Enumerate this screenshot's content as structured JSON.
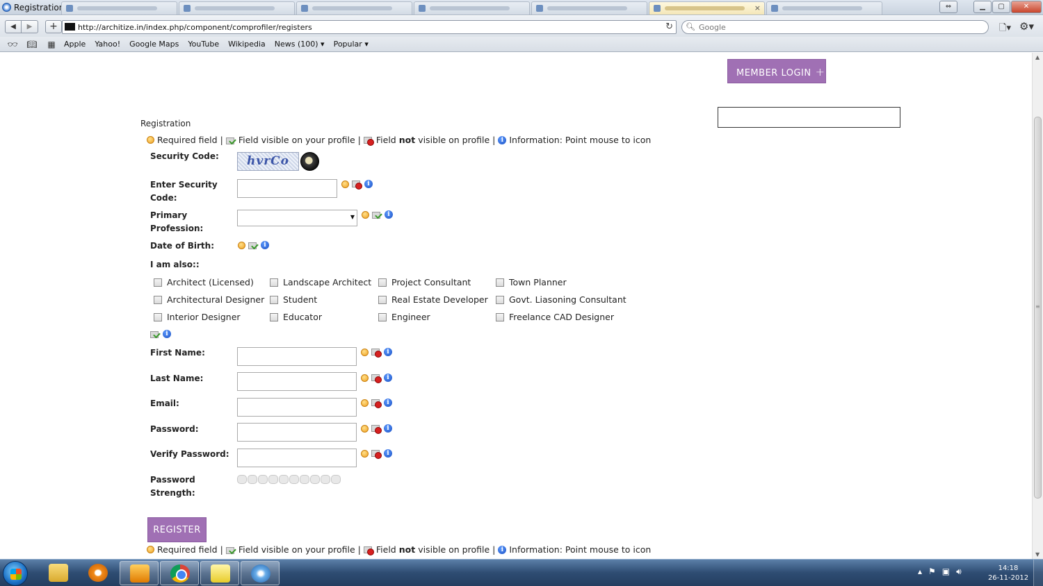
{
  "window": {
    "title": "Registration",
    "tab_count": 8,
    "active_tab_index": 6
  },
  "navbar": {
    "back_icon": "back-arrow-icon",
    "forward_icon": "forward-arrow-icon",
    "url": "http://architize.in/index.php/component/comprofiler/registers",
    "search_placeholder": "Google"
  },
  "bookmarks": {
    "items": [
      "Apple",
      "Yahoo!",
      "Google Maps",
      "YouTube",
      "Wikipedia",
      "News (100) ▾",
      "Popular ▾"
    ]
  },
  "header": {
    "member_login_label": "MEMBER LOGIN",
    "member_login_plus": "+"
  },
  "form": {
    "title": "Registration",
    "legend": {
      "required": "Required field",
      "visible": "Field visible on your profile",
      "not_visible_prefix": "Field",
      "not_visible_bold": "not",
      "not_visible_suffix": "visible on profile",
      "info": "Information: Point mouse to icon",
      "sep": "|"
    },
    "labels": {
      "security_code": "Security Code:",
      "enter_security_line1": "Enter Security",
      "enter_security_line2": "Code:",
      "primary_line1": "Primary",
      "primary_line2": "Profession:",
      "dob": "Date of Birth:",
      "iam_also": "I am also::",
      "first_name": "First Name:",
      "last_name": "Last Name:",
      "email": "Email:",
      "password": "Password:",
      "verify_password": "Verify Password:",
      "strength_line1": "Password",
      "strength_line2": "Strength:"
    },
    "captcha_text": "hvrCo",
    "professions": [
      [
        "Architect (Licensed)",
        "Landscape Architect",
        "Project Consultant",
        "Town Planner"
      ],
      [
        "Architectural Designer",
        "Student",
        "Real Estate Developer",
        "Govt. Liasoning Consultant"
      ],
      [
        "Interior Designer",
        "Educator",
        "Engineer",
        "Freelance CAD Designer"
      ]
    ],
    "register_label": "REGISTER"
  },
  "taskbar": {
    "time": "14:18",
    "date": "26-11-2012"
  },
  "colors": {
    "accent_purple": "#a070b4",
    "required_orange": "#f0a020",
    "info_blue": "#1a4fc2"
  }
}
